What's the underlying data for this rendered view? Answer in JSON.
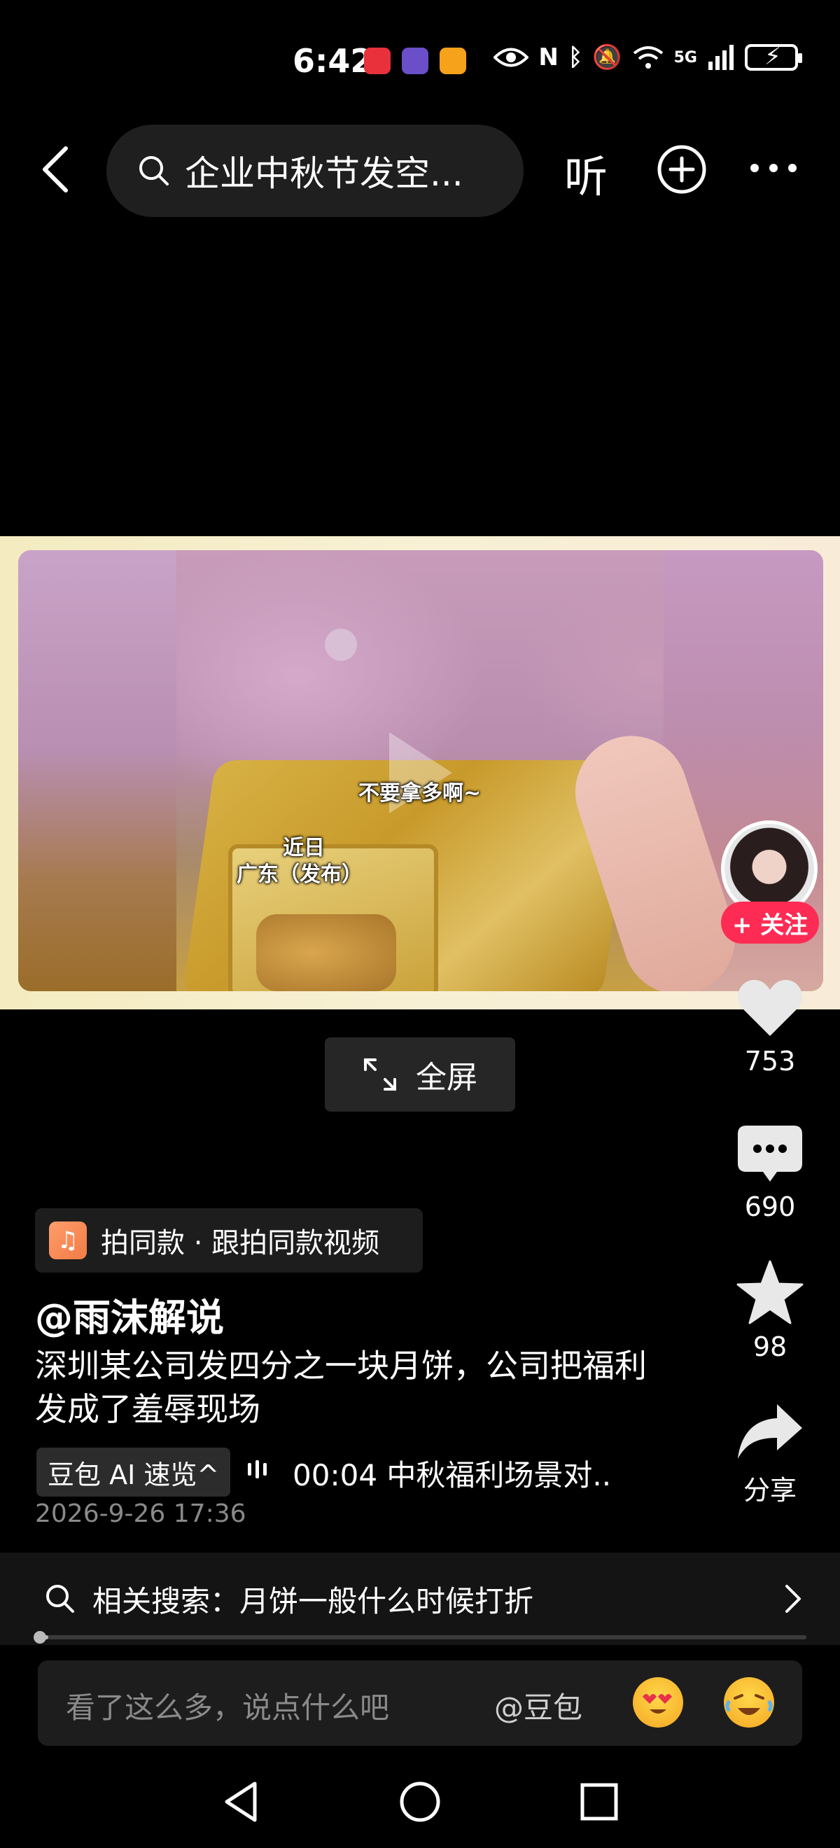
{
  "status_bar": {
    "time": "6:42",
    "network": "5G",
    "icons": [
      "huawei-app-icon",
      "app-icon-2",
      "app-icon-3",
      "eye-icon",
      "nfc-icon",
      "bluetooth-icon",
      "mute-icon",
      "wifi-icon",
      "signal-icon",
      "battery-charging-icon"
    ]
  },
  "top_nav": {
    "search_text": "企业中秋节发空...",
    "listen_label": "听"
  },
  "video": {
    "caption_top": "不要拿多啊~",
    "caption_line1": "近日",
    "caption_line2": "广东（发布）"
  },
  "creator": {
    "follow_label": "+ 关注"
  },
  "actions": {
    "likes": "753",
    "comments": "690",
    "favorites": "98",
    "share_label": "分享"
  },
  "fullscreen_label": "全屏",
  "info": {
    "music_tag": "拍同款 · 跟拍同款视频",
    "author": "@雨沫解说",
    "description": "深圳某公司发四分之一块月饼，公司把福利发成了羞辱现场",
    "ai_tag": "豆包 AI 速览^",
    "ai_summary": "00:04 中秋福利场景对..",
    "post_time": "2026-9-26 17:36"
  },
  "related_search": {
    "text": "相关搜索：月饼一般什么时候打折"
  },
  "playback": {
    "progress": 0.01
  },
  "comment_bar": {
    "placeholder": "看了这么多，说点什么吧",
    "at_label": "@豆包"
  },
  "colors": {
    "background": "#000000",
    "follow_red": "#fe2c55",
    "music_orange": "#f27b45"
  }
}
